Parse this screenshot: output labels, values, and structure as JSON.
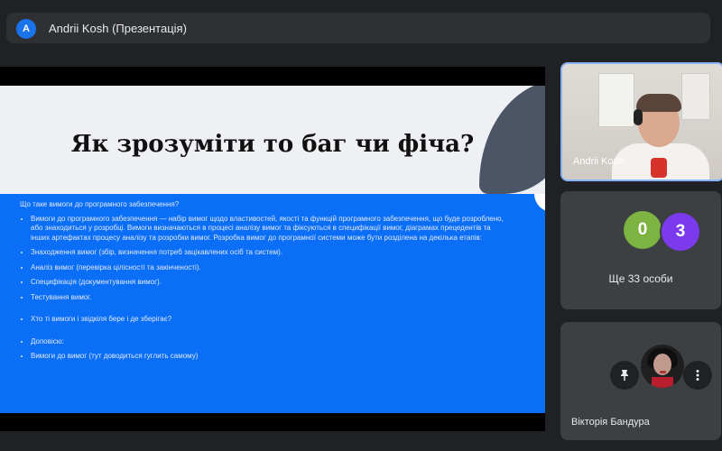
{
  "header": {
    "avatar_letter": "A",
    "presentation_title": "Andrii Kosh (Презентація)"
  },
  "slide": {
    "title": "Як зрозуміти то баг чи фіча?",
    "question": "Що таке вимоги до програмного забезпечення?",
    "bullets": [
      "Вимоги до програмного забезпечення — набір вимог щодо властивостей, якості та функцій програмного забезпечення, що буде розроблено, або знаходиться у розробці. Вимоги визначаються в процесі аналізу вимог та фіксуються в специфікації вимог, діаграмах прецедентів та інших артефактах процесу аналізу та розробки вимог. Розробка вимог до програмної системи може бути розділена на декілька етапів:",
      "Знаходження вимог (збір, визначення потреб зацікавлених осіб та систем).",
      "Аналіз вимог (перевірка цілісності та закінченості).",
      "Специфікація (документування вимог).",
      "Тестування вимог."
    ],
    "bullets_2": [
      "Хто ті вимоги і звідкіля бере і де зберігає?"
    ],
    "bullets_3": [
      "Доповісю:",
      "Вимоги до вимог (тут доводиться гуглить самому)"
    ]
  },
  "participants": {
    "presenter_name": "Andrii Kosh",
    "bubble_counts": [
      "0",
      "3"
    ],
    "others_label": "Ще 33 особи",
    "participant_name": "Вікторія Бандура"
  },
  "colors": {
    "accent_blue": "#1a73e8",
    "slide_blue": "#0b6ef6",
    "bubble_green": "#7cb342",
    "bubble_purple": "#7c3aed"
  },
  "icons": {
    "pin": "pin-icon",
    "more": "more-vert-icon"
  }
}
